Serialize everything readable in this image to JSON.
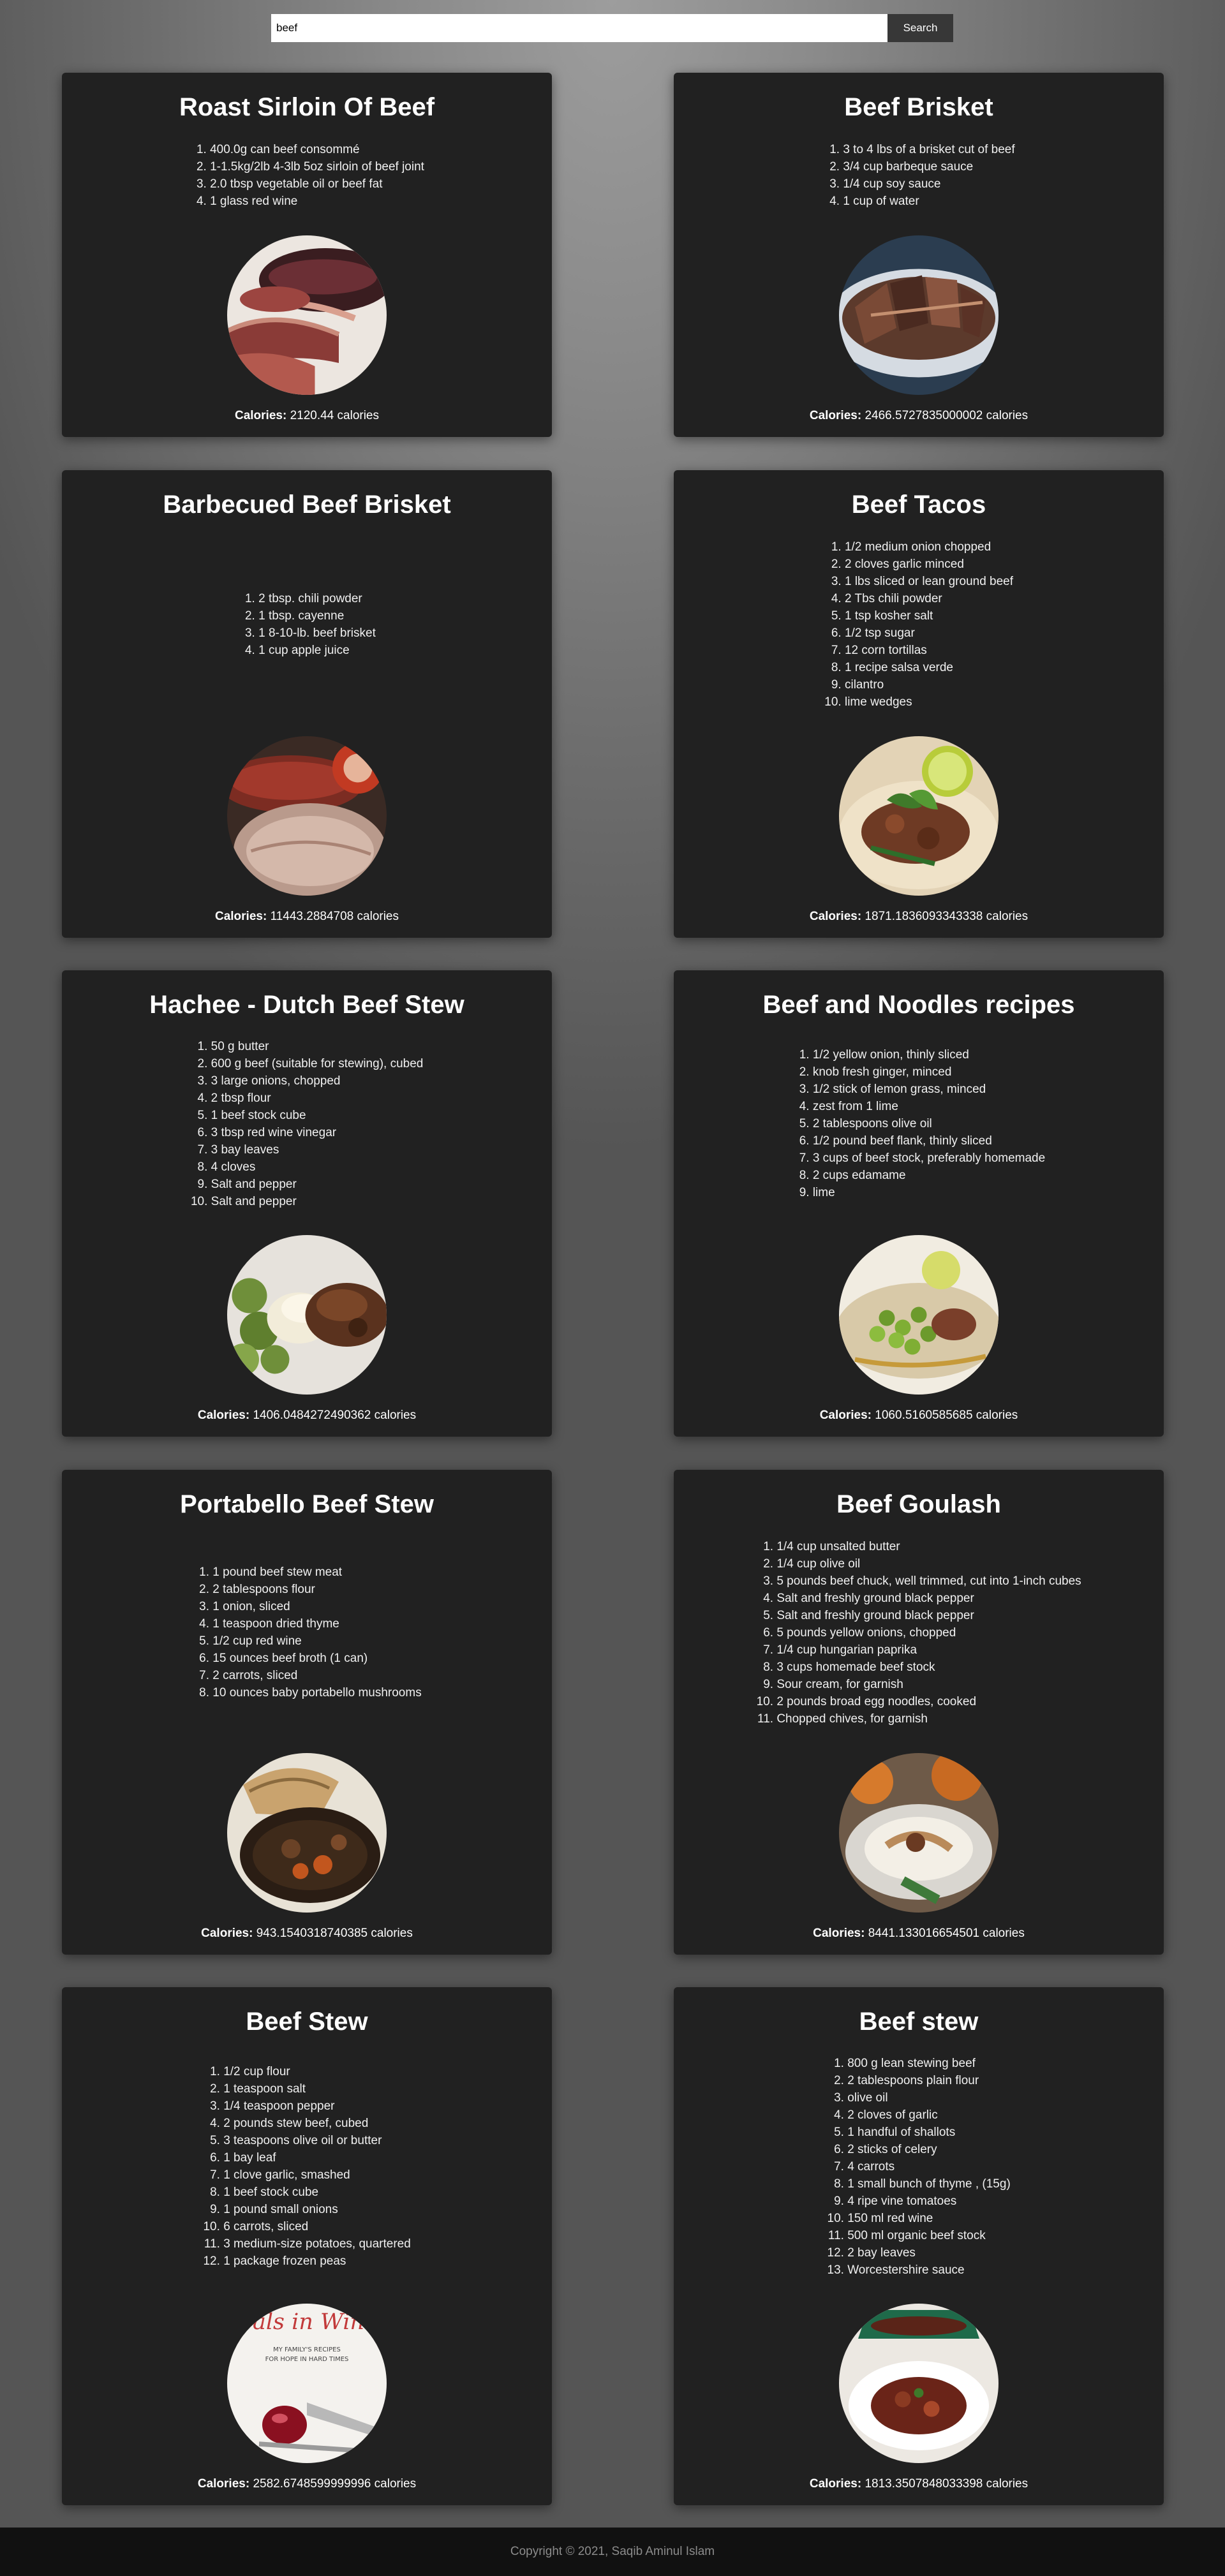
{
  "search": {
    "value": "beef",
    "button_label": "Search"
  },
  "calories_label": "Calories:",
  "calories_unit": "calories",
  "recipes": [
    {
      "title": "Roast Sirloin Of Beef",
      "ingredients": [
        "400.0g can beef consommé",
        "1-1.5kg/2lb 4-3lb 5oz sirloin of beef joint",
        "2.0 tbsp vegetable oil or beef fat",
        "1 glass red wine"
      ],
      "calories": "2120.44",
      "image": "sliced-roast-beef"
    },
    {
      "title": "Beef Brisket",
      "ingredients": [
        "3 to 4 lbs of a brisket cut of beef",
        "3/4 cup barbeque sauce",
        "1/4 cup soy sauce",
        "1 cup of water"
      ],
      "calories": "2466.5727835000002",
      "image": "sliced-brisket-on-plate"
    },
    {
      "title": "Barbecued Beef Brisket",
      "ingredients": [
        "2 tbsp. chili powder",
        "1 tbsp. cayenne",
        "1 8-10-lb. beef brisket",
        "1 cup apple juice"
      ],
      "calories": "11443.2884708",
      "image": "barbecued-brisket-and-sausage"
    },
    {
      "title": "Beef Tacos",
      "ingredients": [
        "1/2 medium onion chopped",
        "2 cloves garlic minced",
        "1 lbs sliced or lean ground beef",
        "2 Tbs chili powder",
        "1 tsp kosher salt",
        "1/2 tsp sugar",
        "12 corn tortillas",
        "1 recipe salsa verde",
        "cilantro",
        "lime wedges"
      ],
      "calories": "1871.1836093343338",
      "image": "beef-tacos-with-lime"
    },
    {
      "title": "Hachee - Dutch Beef Stew",
      "ingredients": [
        "50 g butter",
        "600 g beef (suitable for stewing), cubed",
        "3 large onions, chopped",
        "2 tbsp flour",
        "1 beef stock cube",
        "3 tbsp red wine vinegar",
        "3 bay leaves",
        "4 cloves",
        "Salt and pepper",
        "Salt and pepper"
      ],
      "calories": "1406.0484272490362",
      "image": "stew-with-mash-and-sprouts"
    },
    {
      "title": "Beef and Noodles recipes",
      "ingredients": [
        "1/2 yellow onion, thinly sliced",
        "knob fresh ginger, minced",
        "1/2 stick of lemon grass, minced",
        "zest from 1 lime",
        "2 tablespoons olive oil",
        "1/2 pound beef flank, thinly sliced",
        "3 cups of beef stock, preferably homemade",
        "2 cups edamame",
        "lime"
      ],
      "calories": "1060.5160585685",
      "image": "noodles-with-edamame"
    },
    {
      "title": "Portabello Beef Stew",
      "ingredients": [
        "1 pound beef stew meat",
        "2 tablespoons flour",
        "1 onion, sliced",
        "1 teaspoon dried thyme",
        "1/2 cup red wine",
        "15 ounces beef broth (1 can)",
        "2 carrots, sliced",
        "10 ounces baby portabello mushrooms"
      ],
      "calories": "943.1540318740385",
      "image": "mushroom-beef-stew-with-bread"
    },
    {
      "title": "Beef Goulash",
      "ingredients": [
        "1/4 cup unsalted butter",
        "1/4 cup olive oil",
        "5 pounds beef chuck, well trimmed, cut into 1-inch cubes",
        "Salt and freshly ground black pepper",
        "Salt and freshly ground black pepper",
        "5 pounds yellow onions, chopped",
        "1/4 cup hungarian paprika",
        "3 cups homemade beef stock",
        "Sour cream, for garnish",
        "2 pounds broad egg noodles, cooked",
        "Chopped chives, for garnish"
      ],
      "calories": "8441.133016654501",
      "image": "goulash-with-pumpkins"
    },
    {
      "title": "Beef Stew",
      "ingredients": [
        "1/2 cup flour",
        "1 teaspoon salt",
        "1/4 teaspoon pepper",
        "2 pounds stew beef, cubed",
        "3 teaspoons olive oil or butter",
        "1 bay leaf",
        "1 clove garlic, smashed",
        "1 beef stock cube",
        "1 pound small onions",
        "6 carrots, sliced",
        "3 medium-size potatoes, quartered",
        "1 package frozen peas"
      ],
      "calories": "2582.6748599999996",
      "image": "cookbook-cover",
      "image_text": {
        "title": "Meals in Winter",
        "subtitle": "MY FAMILY'S RECIPES",
        "subtitle2": "FOR HOPE IN HARD TIMES"
      }
    },
    {
      "title": "Beef stew",
      "ingredients": [
        "800 g lean stewing beef",
        "2 tablespoons plain flour",
        "olive oil",
        "2 cloves of garlic",
        "1 handful of shallots",
        "2 sticks of celery",
        "4 carrots",
        "1 small bunch of thyme , (15g)",
        "4 ripe vine tomatoes",
        "150 ml red wine",
        "500 ml organic beef stock",
        "2 bay leaves",
        "Worcestershire sauce"
      ],
      "calories": "1813.3507848033398",
      "image": "beef-stew-bowl-green-pot"
    }
  ],
  "footer": {
    "text": "Copyright © 2021, Saqib Aminul Islam"
  }
}
